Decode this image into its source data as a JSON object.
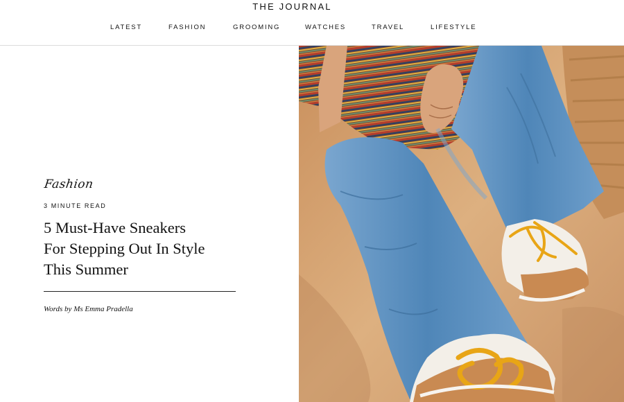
{
  "site": {
    "brand": "THE JOURNAL"
  },
  "nav": {
    "items": [
      {
        "id": "latest",
        "label": "LATEST"
      },
      {
        "id": "fashion",
        "label": "FASHION"
      },
      {
        "id": "grooming",
        "label": "GROOMING"
      },
      {
        "id": "watches",
        "label": "WATCHES"
      },
      {
        "id": "travel",
        "label": "TRAVEL"
      },
      {
        "id": "lifestyle",
        "label": "LIFESTYLE"
      }
    ]
  },
  "article": {
    "category": "Fashion",
    "read_time": "3 MINUTE READ",
    "title_lines": [
      "5 Must-Have Sneakers",
      "For Stepping Out In Style",
      "This Summer"
    ],
    "byline": "Words by Ms Emma Pradella"
  },
  "hero": {
    "description_colors": {
      "sand": "#d4a478",
      "denim": "#5b8fbd",
      "sneaker_tan": "#c98a52",
      "lace_yellow": "#e8a516",
      "stripe_red": "#c0392b"
    }
  }
}
